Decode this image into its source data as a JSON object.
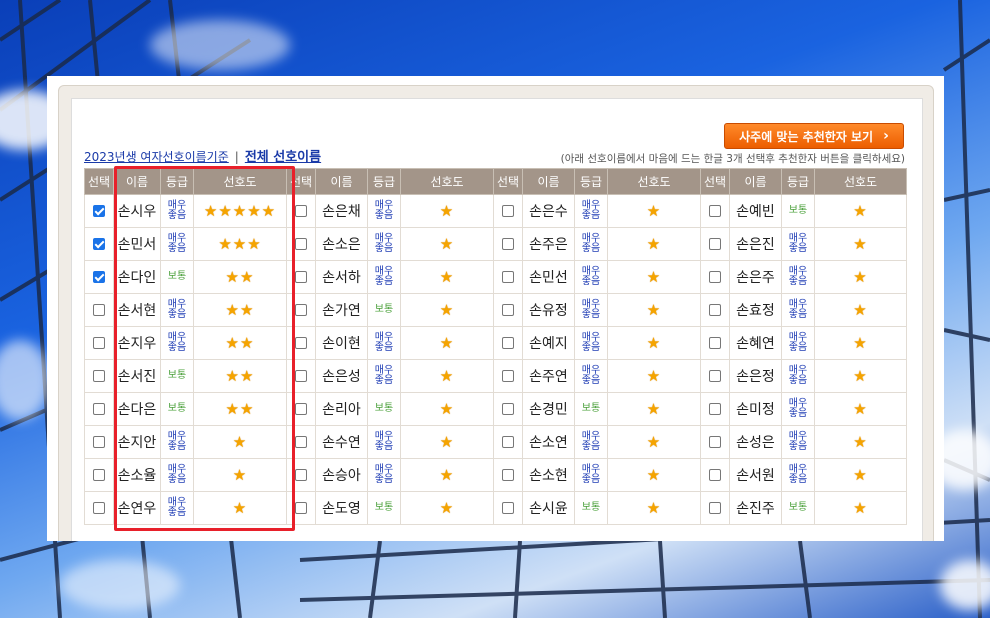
{
  "header": {
    "button_label": "사주에 맞는 추천한자 보기",
    "button_arrow": "›",
    "link_year": "2023년생 여자선호이름기준",
    "link_sep": "|",
    "link_all": "전체 선호이름",
    "hint": "(아래 선호이름에서 마음에 드는 한글 3개 선택후 추천한자 버튼을 클릭하세요)"
  },
  "table": {
    "headers": [
      "선택",
      "이름",
      "등급",
      "선호도"
    ],
    "grade_labels": {
      "very": "매우좋음",
      "normal": "보통"
    },
    "star_glyph": "★",
    "columns": [
      [
        {
          "checked": true,
          "name": "손시우",
          "grade": "very",
          "stars": 5
        },
        {
          "checked": true,
          "name": "손민서",
          "grade": "very",
          "stars": 3
        },
        {
          "checked": true,
          "name": "손다인",
          "grade": "normal",
          "stars": 2
        },
        {
          "checked": false,
          "name": "손서현",
          "grade": "very",
          "stars": 2
        },
        {
          "checked": false,
          "name": "손지우",
          "grade": "very",
          "stars": 2
        },
        {
          "checked": false,
          "name": "손서진",
          "grade": "normal",
          "stars": 2
        },
        {
          "checked": false,
          "name": "손다은",
          "grade": "normal",
          "stars": 2
        },
        {
          "checked": false,
          "name": "손지안",
          "grade": "very",
          "stars": 1
        },
        {
          "checked": false,
          "name": "손소율",
          "grade": "very",
          "stars": 1
        },
        {
          "checked": false,
          "name": "손연우",
          "grade": "very",
          "stars": 1
        }
      ],
      [
        {
          "checked": false,
          "name": "손은채",
          "grade": "very",
          "stars": 1
        },
        {
          "checked": false,
          "name": "손소은",
          "grade": "very",
          "stars": 1
        },
        {
          "checked": false,
          "name": "손서하",
          "grade": "very",
          "stars": 1
        },
        {
          "checked": false,
          "name": "손가연",
          "grade": "normal",
          "stars": 1
        },
        {
          "checked": false,
          "name": "손이현",
          "grade": "very",
          "stars": 1
        },
        {
          "checked": false,
          "name": "손은성",
          "grade": "very",
          "stars": 1
        },
        {
          "checked": false,
          "name": "손리아",
          "grade": "normal",
          "stars": 1
        },
        {
          "checked": false,
          "name": "손수연",
          "grade": "very",
          "stars": 1
        },
        {
          "checked": false,
          "name": "손승아",
          "grade": "very",
          "stars": 1
        },
        {
          "checked": false,
          "name": "손도영",
          "grade": "normal",
          "stars": 1
        }
      ],
      [
        {
          "checked": false,
          "name": "손은수",
          "grade": "very",
          "stars": 1
        },
        {
          "checked": false,
          "name": "손주은",
          "grade": "very",
          "stars": 1
        },
        {
          "checked": false,
          "name": "손민선",
          "grade": "very",
          "stars": 1
        },
        {
          "checked": false,
          "name": "손유정",
          "grade": "very",
          "stars": 1
        },
        {
          "checked": false,
          "name": "손예지",
          "grade": "very",
          "stars": 1
        },
        {
          "checked": false,
          "name": "손주연",
          "grade": "very",
          "stars": 1
        },
        {
          "checked": false,
          "name": "손경민",
          "grade": "normal",
          "stars": 1
        },
        {
          "checked": false,
          "name": "손소연",
          "grade": "very",
          "stars": 1
        },
        {
          "checked": false,
          "name": "손소현",
          "grade": "very",
          "stars": 1
        },
        {
          "checked": false,
          "name": "손시윤",
          "grade": "normal",
          "stars": 1
        }
      ],
      [
        {
          "checked": false,
          "name": "손예빈",
          "grade": "normal",
          "stars": 1
        },
        {
          "checked": false,
          "name": "손은진",
          "grade": "very",
          "stars": 1
        },
        {
          "checked": false,
          "name": "손은주",
          "grade": "very",
          "stars": 1
        },
        {
          "checked": false,
          "name": "손효정",
          "grade": "very",
          "stars": 1
        },
        {
          "checked": false,
          "name": "손혜연",
          "grade": "very",
          "stars": 1
        },
        {
          "checked": false,
          "name": "손은정",
          "grade": "very",
          "stars": 1
        },
        {
          "checked": false,
          "name": "손미정",
          "grade": "very",
          "stars": 1
        },
        {
          "checked": false,
          "name": "손성은",
          "grade": "very",
          "stars": 1
        },
        {
          "checked": false,
          "name": "손서원",
          "grade": "very",
          "stars": 1
        },
        {
          "checked": false,
          "name": "손진주",
          "grade": "normal",
          "stars": 1
        }
      ]
    ]
  },
  "colors": {
    "header_bg": "#a39589",
    "very_good": "#1e3cb4",
    "normal": "#4aa03a",
    "star": "#f5a400",
    "highlight": "#e8202a",
    "button": "#f07010"
  }
}
